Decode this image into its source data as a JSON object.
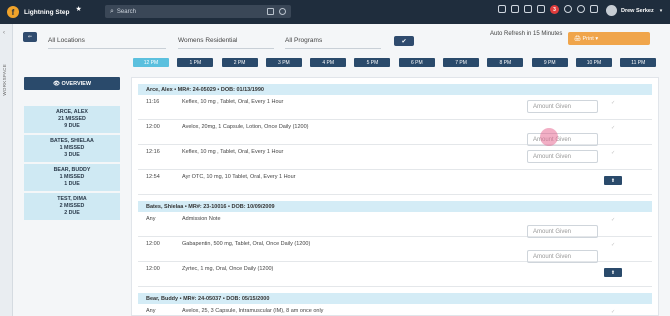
{
  "app": {
    "title": "Lightning Step",
    "logo_letter": "f"
  },
  "search": {
    "placeholder": "Search"
  },
  "notifications": {
    "count": "3"
  },
  "user": {
    "name": "Drew Serkez"
  },
  "rail": {
    "label": "WORKSPACE"
  },
  "filters": {
    "back_label": "⇐",
    "location": "All Locations",
    "program_type": "Womens Residential",
    "programs": "All Programs",
    "apply_label": "✔"
  },
  "refresh": {
    "label": "Auto Refresh in 15 Minutes"
  },
  "print": {
    "label": "🖨 Print  ▾"
  },
  "hours": [
    "12 PM",
    "1 PM",
    "2 PM",
    "3 PM",
    "4 PM",
    "5 PM",
    "6 PM",
    "7 PM",
    "8 PM",
    "9 PM",
    "10 PM",
    "11 PM"
  ],
  "active_hour": "12 PM",
  "overview": {
    "label": "👁 OVERVIEW"
  },
  "patients": [
    {
      "name": "ARCE, ALEX",
      "missed": "21 MISSED",
      "due": "9 DUE"
    },
    {
      "name": "BATES, SHIELAA",
      "missed": "1 MISSED",
      "due": "3 DUE"
    },
    {
      "name": "BEAR, BUDDY",
      "missed": "1 MISSED",
      "due": "1 DUE"
    },
    {
      "name": "TEST, DIMA",
      "missed": "2 MISSED",
      "due": "2 DUE"
    }
  ],
  "groups": [
    {
      "header": "Arce, Alex   •   MR#: 24-05029   •   DOB: 01/13/1990",
      "meds": [
        {
          "time": "11:16",
          "desc": "Keflex, 10 mg , Tablet, Oral, Every 1 Hour",
          "amount_placeholder": "Amount Given",
          "has_button": false
        },
        {
          "time": "12:00",
          "desc": "Avelox, 20mg, 1 Capsule, Lotion, Once Daily (1200)",
          "amount_placeholder": "Amount Given",
          "has_button": false
        },
        {
          "time": "12:16",
          "desc": "Keflex, 10 mg , Tablet, Oral, Every 1 Hour",
          "amount_placeholder": "Amount Given",
          "has_button": false
        },
        {
          "time": "12:54",
          "desc": "Ayr OTC, 10 mg, 10 Tablet, Oral, Every 1 Hour",
          "amount_placeholder": "",
          "has_button": true
        }
      ]
    },
    {
      "header": "Bates, Shielaa   •   MR#: 23-10016   •   DOB: 10/09/2009",
      "meds": [
        {
          "time": "Any",
          "desc": "Admission Note",
          "amount_placeholder": "Amount Given",
          "has_button": false
        },
        {
          "time": "12:00",
          "desc": "Gabapentin, 500 mg, Tablet, Oral, Once Daily (1200)",
          "amount_placeholder": "Amount Given",
          "has_button": false
        },
        {
          "time": "12:00",
          "desc": "Zyrtec, 1 mg, Oral, Once Daily (1200)",
          "amount_placeholder": "",
          "has_button": true
        }
      ]
    },
    {
      "header": "Bear, Buddy   •   MR#: 24-05037   •   DOB: 05/15/2000",
      "meds": [
        {
          "time": "Any",
          "desc": "Avelox, 25, 3 Capsule, Intramuscular (IM), 8 am once only",
          "amount_placeholder": "Amount Given",
          "has_button": false
        }
      ]
    }
  ],
  "colors": {
    "topbar": "#1f2d3d",
    "accent_navy": "#2a4a6b",
    "active_hour": "#5bc0de",
    "print": "#f0a54b",
    "patient_card": "#cfe9f3",
    "group_header": "#d4ecf6"
  }
}
